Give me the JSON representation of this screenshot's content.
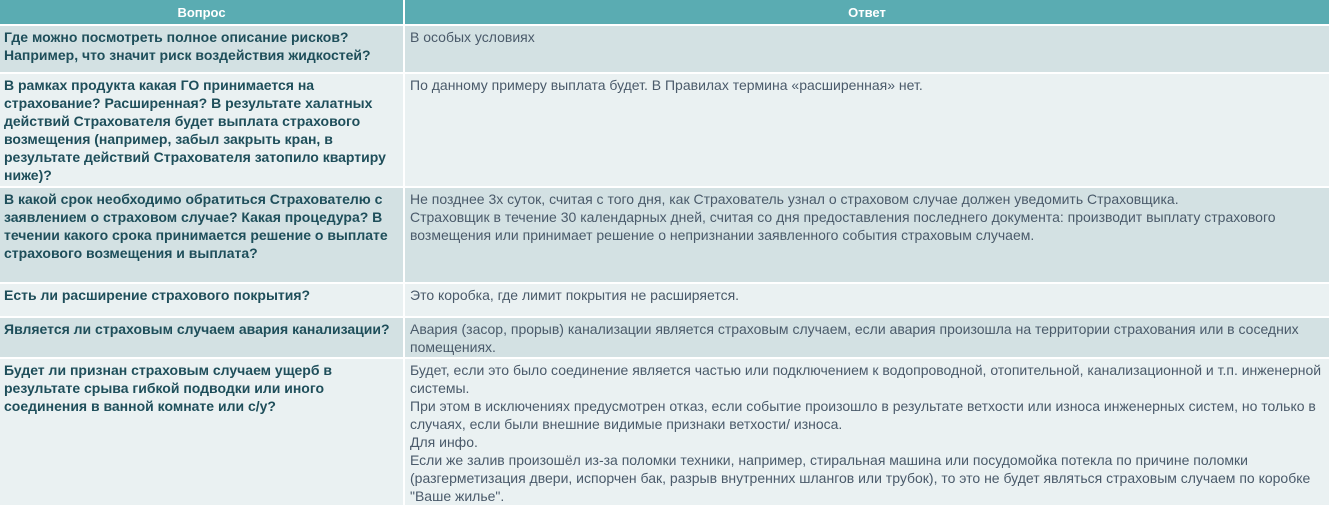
{
  "header": {
    "question_label": "Вопрос",
    "answer_label": "Ответ"
  },
  "rows": [
    {
      "question": "Где можно посмотреть полное описание рисков? Например, что значит риск воздействия жидкостей?",
      "answer": [
        "В особых условиях"
      ]
    },
    {
      "question": "В рамках продукта какая ГО принимается на страхование? Расширенная? В результате халатных действий Страхователя будет выплата страхового возмещения (например, забыл закрыть кран, в результате действий Страхователя затопило квартиру ниже)?",
      "answer": [
        "По данному примеру выплата будет. В Правилах термина «расширенная» нет."
      ]
    },
    {
      "question": "В какой срок необходимо обратиться Страхователю с заявлением о страховом случае? Какая процедура? В течении какого срока принимается решение о выплате страхового возмещения и выплата?",
      "answer": [
        "Не позднее 3х суток, считая с того дня, как Страхователь узнал о страховом случае должен уведомить Страховщика.",
        "Страховщик в течение 30 календарных дней, считая со дня предоставления последнего документа: производит выплату страхового возмещения или принимает решение о непризнании заявленного события страховым случаем."
      ]
    },
    {
      "question": "Есть ли расширение страхового покрытия?",
      "answer": [
        "Это коробка, где лимит покрытия не расширяется."
      ]
    },
    {
      "question": "Является ли страховым случаем авария канализации?",
      "answer": [
        "Авария (засор, прорыв) канализации является страховым случаем, если авария произошла на территории страхования или в соседних помещениях."
      ]
    },
    {
      "question": "Будет ли признан страховым случаем ущерб в результате срыва гибкой подводки или иного соединения в ванной комнате или с/у?",
      "answer": [
        "Будет, если это было соединение является частью или подключением к водопроводной, отопительной, канализационной и т.п. инженерной системы.",
        "При этом в исключениях предусмотрен отказ, если событие произошло в результате ветхости или износа инженерных систем, но только в случаях, если были внешние видимые признаки ветхости/ износа.",
        "Для инфо.",
        "Если же залив произошёл из-за поломки техники, например, стиральная машина или посудомойка потекла по причине поломки (разгерметизация двери, испорчен бак, разрыв внутренних шлангов или трубок), то это не будет являться страховым случаем по коробке \"Ваше жилье\"."
      ]
    }
  ]
}
